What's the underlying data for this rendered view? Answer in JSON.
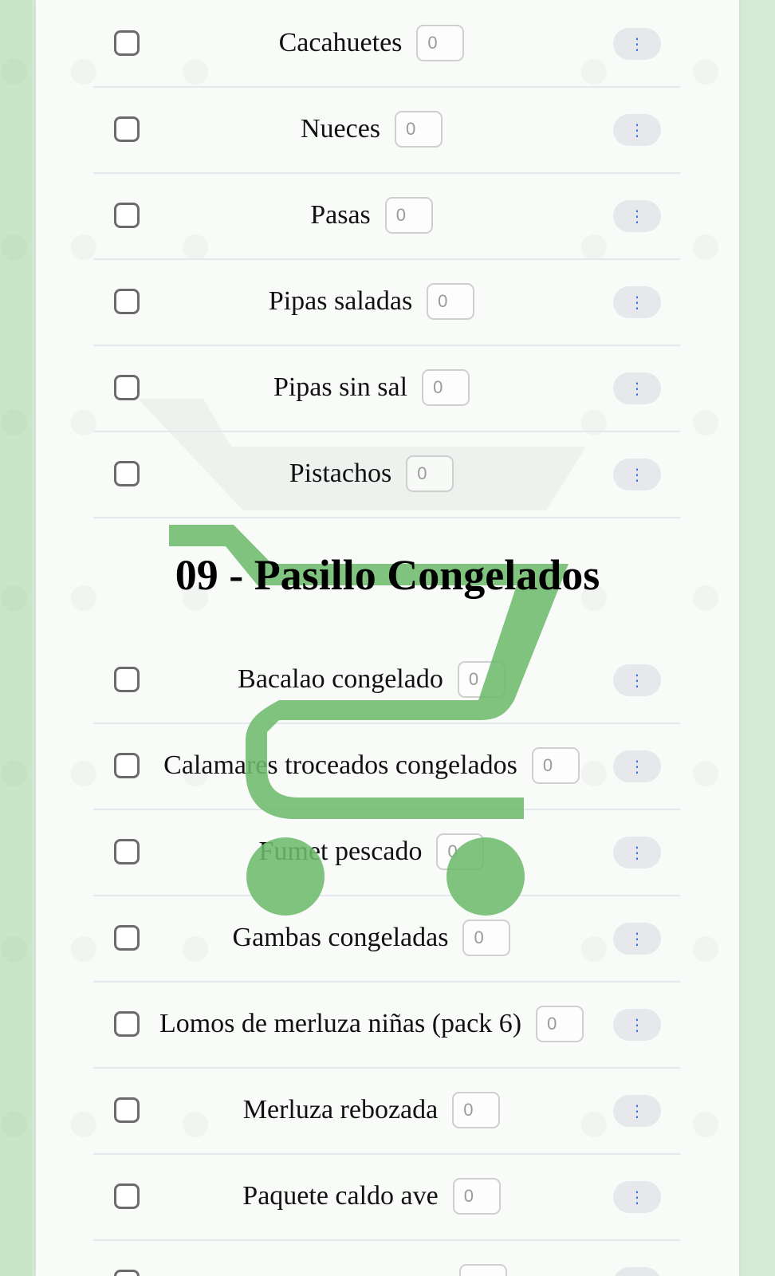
{
  "top_items": [
    {
      "label": "Cacahuetes",
      "qty": "0"
    },
    {
      "label": "Nueces",
      "qty": "0"
    },
    {
      "label": "Pasas",
      "qty": "0"
    },
    {
      "label": "Pipas saladas",
      "qty": "0"
    },
    {
      "label": "Pipas sin sal",
      "qty": "0"
    },
    {
      "label": "Pistachos",
      "qty": "0"
    }
  ],
  "section": {
    "title": "09 - Pasillo Congelados"
  },
  "section_items": [
    {
      "label": "Bacalao congelado",
      "qty": "0"
    },
    {
      "label": "Calamares troceados congelados",
      "qty": "0"
    },
    {
      "label": "Fumet pescado",
      "qty": "0"
    },
    {
      "label": "Gambas congeladas",
      "qty": "0"
    },
    {
      "label": "Lomos de merluza niñas (pack 6)",
      "qty": "0"
    },
    {
      "label": "Merluza rebozada",
      "qty": "0"
    },
    {
      "label": "Paquete caldo ave",
      "qty": "0"
    }
  ],
  "menu_glyph": "⋮",
  "colors": {
    "accent_green": "#6dbb6d",
    "menu_dots": "#3f6fe0"
  },
  "icons": [
    "shopping-cart-icon",
    "checkbox-icon",
    "kebab-menu-icon"
  ]
}
